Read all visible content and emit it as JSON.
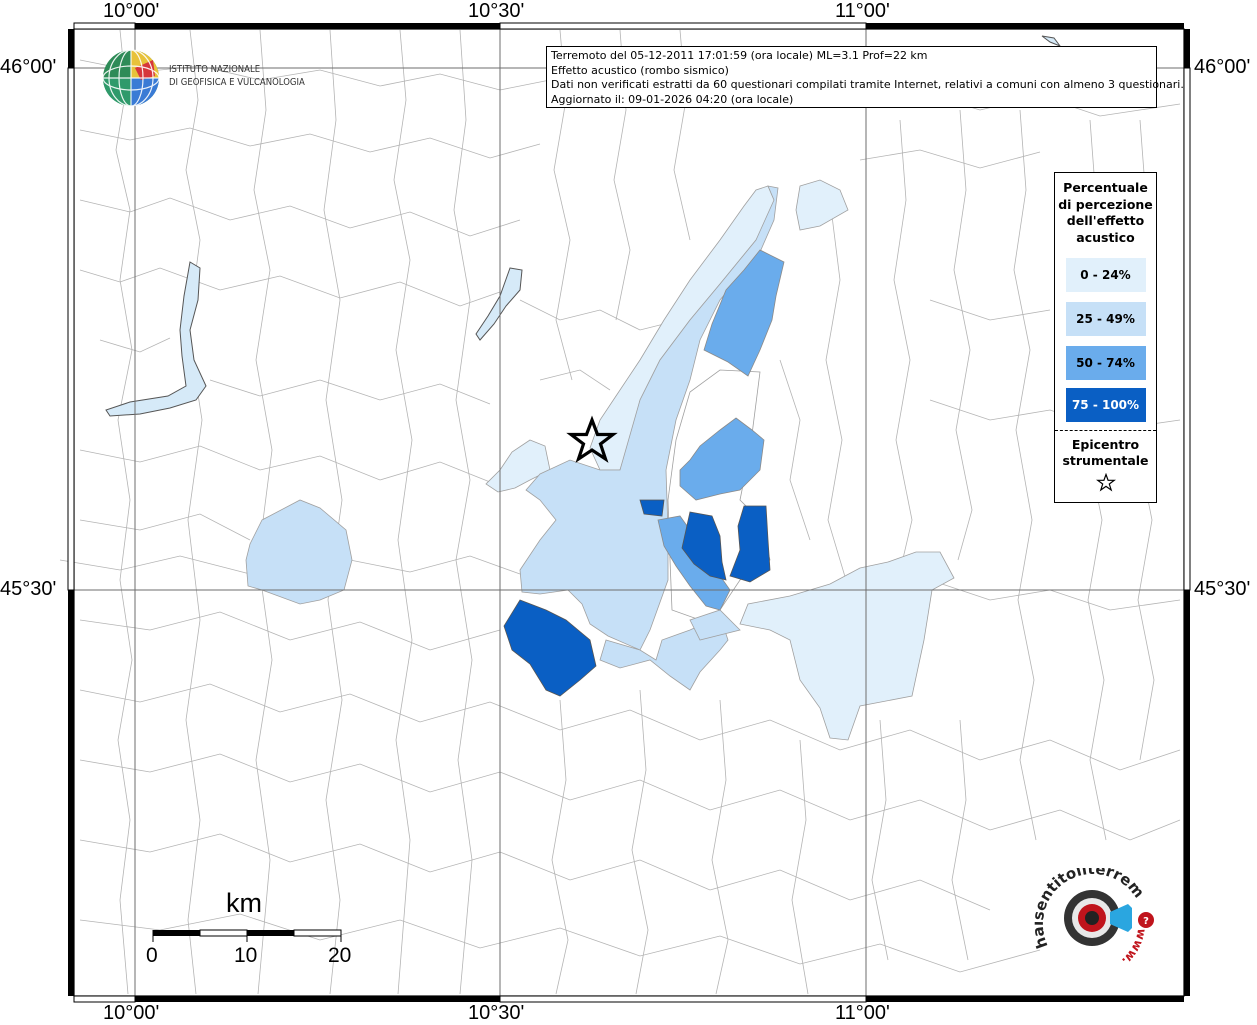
{
  "header": {
    "event_line": "Terremoto del 05-12-2011 17:01:59 (ora locale) ML=3.1 Prof=22 km",
    "effect_line": "Effetto acustico (rombo sismico)",
    "data_line": "Dati non verificati estratti da 60 questionari compilati tramite Internet, relativi a comuni con almeno 3 questionari.",
    "updated_line": "Aggiornato il: 09-01-2026 04:20 (ora locale)"
  },
  "axes": {
    "lon_ticks": [
      "10°00'",
      "10°30'",
      "11°00'"
    ],
    "lat_ticks": [
      "46°00'",
      "45°30'"
    ]
  },
  "legend": {
    "title_lines": [
      "Percentuale",
      "di percezione",
      "dell'effetto",
      "acustico"
    ],
    "classes": [
      {
        "label": "0 - 24%",
        "color": "#e1f0fb",
        "text_color": "#000000"
      },
      {
        "label": "25 - 49%",
        "color": "#c6e0f7",
        "text_color": "#000000"
      },
      {
        "label": "50 - 74%",
        "color": "#6aacec",
        "text_color": "#000000"
      },
      {
        "label": "75 - 100%",
        "color": "#0a5fc4",
        "text_color": "#ffffff"
      }
    ],
    "epicenter_lines": [
      "Epicentro",
      "strumentale"
    ],
    "star_icon": "star-outline-icon"
  },
  "logos": {
    "ingv_lines": [
      "Istituto Nazionale",
      "di Geofisica e Vulcanologia"
    ],
    "hst_text": "haisentitoilterremoto.it",
    "hst_www": "www."
  },
  "scale_bar": {
    "unit": "km",
    "ticks": [
      "0",
      "10",
      "20"
    ]
  },
  "colors": {
    "lake": "#d6eaf8",
    "pale": "#e1f0fb",
    "light": "#c6e0f7",
    "medium": "#6aacec",
    "dark": "#0a5fc4",
    "boundary": "#b4b4b4",
    "grid": "#6e6e6e"
  }
}
